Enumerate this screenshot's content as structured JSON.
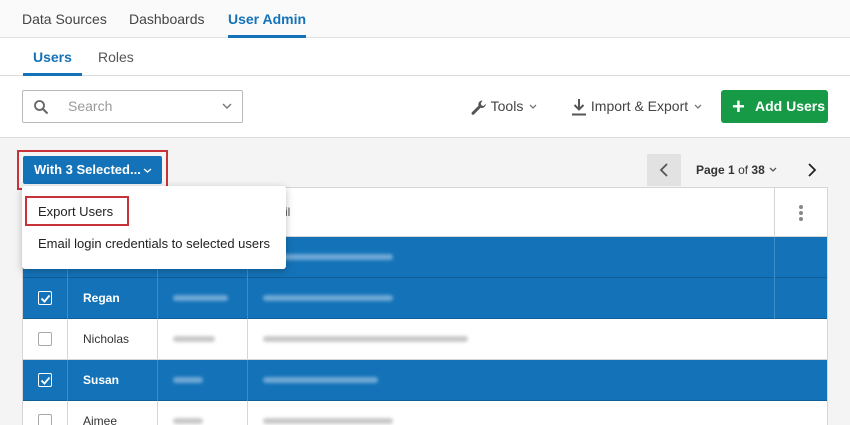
{
  "topnav": {
    "tabs": [
      "Data Sources",
      "Dashboards",
      "User Admin"
    ],
    "active": "User Admin"
  },
  "subnav": {
    "tabs": [
      "Users",
      "Roles"
    ],
    "active": "Users"
  },
  "toolbar": {
    "search_placeholder": "Search",
    "tools_label": "Tools",
    "import_export_label": "Import & Export",
    "add_users_label": "Add Users"
  },
  "selection": {
    "label": "With 3 Selected..."
  },
  "pagination": {
    "prefix": "Page",
    "current": "1",
    "of": "of",
    "total": "38"
  },
  "menu": {
    "items": [
      "Export Users",
      "Email login credentials to selected users"
    ]
  },
  "table": {
    "email_header_fragment": "il",
    "rows": [
      {
        "name": "",
        "selected": true
      },
      {
        "name": "Regan",
        "selected": true
      },
      {
        "name": "Nicholas",
        "selected": false
      },
      {
        "name": "Susan",
        "selected": true
      },
      {
        "name": "Aimee",
        "selected": false
      }
    ]
  },
  "colors": {
    "primary": "#1473b8",
    "success": "#169a46",
    "highlight": "#c8333a"
  },
  "icons": [
    "search-icon",
    "wrench-icon",
    "download-icon",
    "chevron-down-icon",
    "plus-icon",
    "chevron-left-icon",
    "chevron-right-icon",
    "kebab-icon",
    "checkmark-icon"
  ]
}
